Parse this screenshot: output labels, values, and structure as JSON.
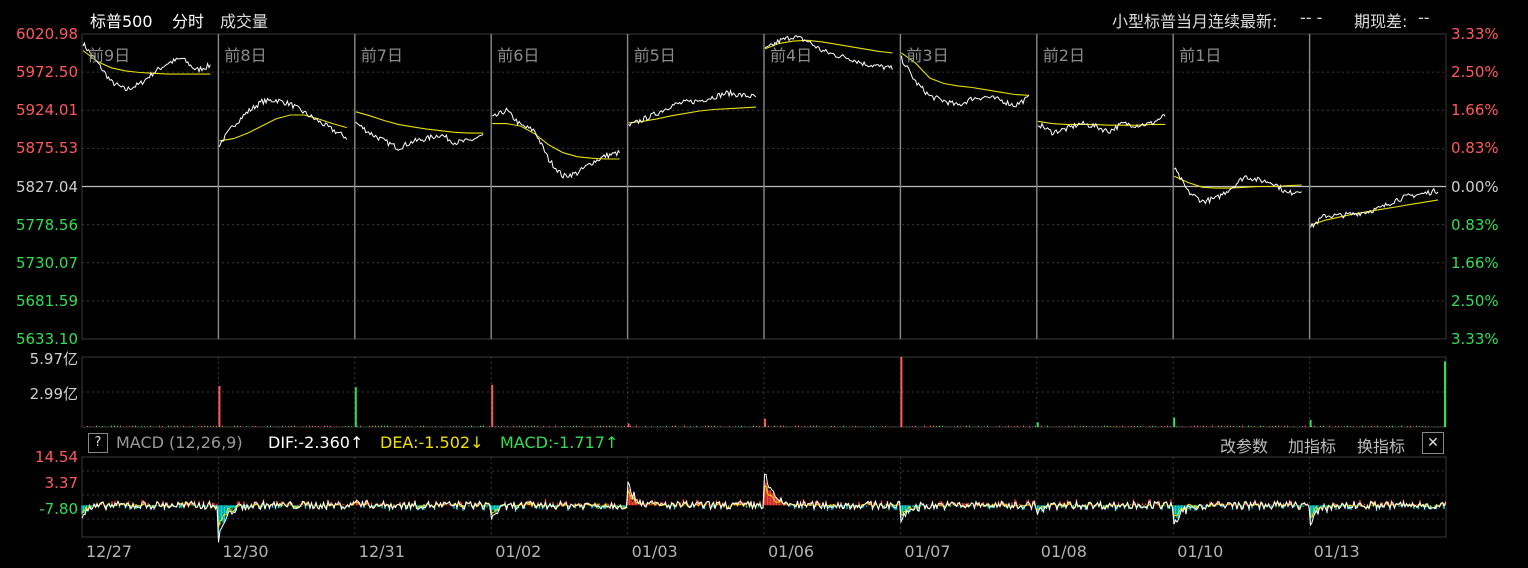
{
  "header": {
    "title": "标普500",
    "mode": "分时",
    "volume_label": "成交量",
    "contract_label": "小型标普当月连续最新:",
    "contract_value": "--  -",
    "spread_label": "期现差:",
    "spread_value": "--"
  },
  "colors": {
    "background": "#000000",
    "grid": "#3a3a3a",
    "up": "#ff5a5a",
    "down": "#33dd55",
    "price_line": "#ffffff",
    "avg_line": "#e8e000",
    "dif_line": "#ffffff",
    "dea_line": "#f0e000",
    "macd_pos": "#ff4444",
    "macd_neg": "#00dddd"
  },
  "chart_data": [
    {
      "type": "line",
      "name": "price",
      "y_labels_left": [
        "6020.98",
        "5972.50",
        "5924.01",
        "5875.53",
        "5827.04",
        "5778.56",
        "5730.07",
        "5681.59",
        "5633.10"
      ],
      "y_labels_right": [
        "3.33%",
        "2.50%",
        "1.66%",
        "0.83%",
        "0.00%",
        "0.83%",
        "1.66%",
        "2.50%",
        "3.33%"
      ],
      "ylim": [
        5633.1,
        6020.98
      ],
      "reference": 5827.04,
      "day_labels": [
        "前9日",
        "前8日",
        "前7日",
        "前6日",
        "前5日",
        "前4日",
        "前3日",
        "前2日",
        "前1日",
        ""
      ],
      "dates": [
        "12/27",
        "12/30",
        "12/31",
        "01/02",
        "01/03",
        "01/06",
        "01/07",
        "01/08",
        "01/10",
        "01/13"
      ],
      "sessions": [
        {
          "date": "12/27",
          "price": [
            6009,
            5985,
            5960,
            5950,
            5957,
            5972,
            5984,
            5990,
            5975,
            5981
          ],
          "avg": [
            6000,
            5986,
            5978,
            5974,
            5972,
            5971,
            5970,
            5970,
            5970,
            5970
          ]
        },
        {
          "date": "12/30",
          "price": [
            5880,
            5905,
            5922,
            5935,
            5937,
            5932,
            5921,
            5910,
            5899,
            5889
          ],
          "avg": [
            5885,
            5888,
            5895,
            5904,
            5913,
            5918,
            5918,
            5913,
            5907,
            5902
          ]
        },
        {
          "date": "12/31",
          "price": [
            5908,
            5895,
            5885,
            5876,
            5884,
            5888,
            5893,
            5883,
            5885,
            5892
          ],
          "avg": [
            5922,
            5917,
            5911,
            5906,
            5903,
            5900,
            5898,
            5896,
            5895,
            5895
          ]
        },
        {
          "date": "01/02",
          "price": [
            5914,
            5924,
            5905,
            5898,
            5861,
            5840,
            5844,
            5857,
            5866,
            5870
          ],
          "avg": [
            5907,
            5907,
            5904,
            5894,
            5880,
            5870,
            5865,
            5863,
            5862,
            5862
          ]
        },
        {
          "date": "01/03",
          "price": [
            5904,
            5912,
            5920,
            5930,
            5934,
            5936,
            5941,
            5946,
            5943,
            5941
          ],
          "avg": [
            5908,
            5910,
            5913,
            5917,
            5920,
            5923,
            5925,
            5926,
            5927,
            5928
          ]
        },
        {
          "date": "01/06",
          "price": [
            6001,
            6012,
            6018,
            6012,
            6000,
            5994,
            5990,
            5983,
            5980,
            5977
          ],
          "avg": [
            6002,
            6009,
            6012,
            6013,
            6011,
            6008,
            6005,
            6002,
            5999,
            5997
          ]
        },
        {
          "date": "01/07",
          "price": [
            5990,
            5960,
            5942,
            5936,
            5930,
            5939,
            5941,
            5937,
            5930,
            5940
          ],
          "avg": [
            5997,
            5984,
            5965,
            5958,
            5955,
            5953,
            5950,
            5947,
            5944,
            5943
          ]
        },
        {
          "date": "01/08",
          "price": [
            5907,
            5896,
            5900,
            5907,
            5904,
            5897,
            5907,
            5905,
            5907,
            5917
          ],
          "avg": [
            5910,
            5907,
            5906,
            5906,
            5906,
            5905,
            5905,
            5905,
            5906,
            5906
          ]
        },
        {
          "date": "01/10",
          "price": [
            5850,
            5820,
            5808,
            5812,
            5825,
            5840,
            5835,
            5832,
            5818,
            5823
          ],
          "avg": [
            5840,
            5832,
            5826,
            5825,
            5825,
            5826,
            5827,
            5827,
            5828,
            5829
          ]
        },
        {
          "date": "01/13",
          "price": [
            5775,
            5790,
            5790,
            5792,
            5795,
            5800,
            5810,
            5815,
            5818,
            5822
          ],
          "avg": [
            5778,
            5784,
            5788,
            5792,
            5795,
            5798,
            5801,
            5804,
            5807,
            5810
          ]
        }
      ]
    },
    {
      "type": "bar",
      "name": "volume",
      "y_labels": [
        "5.97亿",
        "2.99亿"
      ],
      "ylim": [
        0,
        5.97
      ],
      "unit": "亿",
      "session_open_volume": [
        {
          "date": "12/30",
          "value": 3.5,
          "dir": "up"
        },
        {
          "date": "12/31",
          "value": 3.4,
          "dir": "down"
        },
        {
          "date": "01/02",
          "value": 3.6,
          "dir": "up"
        },
        {
          "date": "01/03",
          "value": 0.3,
          "dir": "up"
        },
        {
          "date": "01/06",
          "value": 0.7,
          "dir": "up"
        },
        {
          "date": "01/07",
          "value": 5.97,
          "dir": "up"
        },
        {
          "date": "01/08",
          "value": 0.4,
          "dir": "down"
        },
        {
          "date": "01/10",
          "value": 0.8,
          "dir": "down"
        },
        {
          "date": "01/13",
          "value": 0.6,
          "dir": "down"
        },
        {
          "date": "01/13-end",
          "value": 5.6,
          "dir": "down"
        }
      ]
    },
    {
      "type": "line",
      "name": "macd",
      "y_labels": [
        "14.54",
        "3.37",
        "-7.80"
      ],
      "ylim": [
        -11.5,
        17.5
      ],
      "params": "MACD (12,26,9)",
      "dif": "DIF:-2.360",
      "dea": "DEA:-1.502",
      "macd": "MACD:-1.717",
      "dif_arrow": "↑",
      "dea_arrow": "↓",
      "macd_arrow": "↑",
      "session_spikes": [
        {
          "date": "12/27",
          "dif": -4,
          "macd": -2
        },
        {
          "date": "12/30",
          "dif": -13,
          "macd": -9
        },
        {
          "date": "12/31",
          "dif": 2,
          "macd": 1
        },
        {
          "date": "01/02",
          "dif": -5,
          "macd": -3
        },
        {
          "date": "01/03",
          "dif": 8,
          "macd": 5
        },
        {
          "date": "01/06",
          "dif": 13,
          "macd": 8
        },
        {
          "date": "01/07",
          "dif": -6,
          "macd": -4
        },
        {
          "date": "01/08",
          "dif": -3,
          "macd": -2
        },
        {
          "date": "01/10",
          "dif": -9,
          "macd": -6
        },
        {
          "date": "01/13",
          "dif": -8,
          "macd": -5
        }
      ]
    }
  ],
  "macd_toolbar": {
    "help": "?",
    "change_params": "改参数",
    "add_indicator": "加指标",
    "switch_indicator": "换指标",
    "close": "✕"
  }
}
